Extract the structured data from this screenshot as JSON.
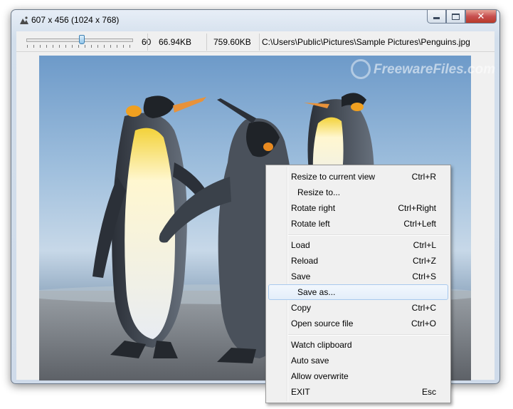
{
  "window": {
    "title": "607 x 456 (1024 x 768)",
    "caption_buttons": {
      "minimize_icon": "minimize-icon",
      "maximize_icon": "maximize-icon",
      "close_glyph": "✕"
    }
  },
  "toolbar": {
    "zoom_slider_value": "60",
    "file_size": "66.94KB",
    "memory_size": "759.60KB",
    "file_path": "C:\\Users\\Public\\Pictures\\Sample Pictures\\Penguins.jpg"
  },
  "watermark": {
    "text": "FreewareFiles.com"
  },
  "context_menu": {
    "hovered_item": "Save as...",
    "groups": [
      [
        {
          "label": "Resize to current view",
          "shortcut": "Ctrl+R"
        },
        {
          "label": "Resize to...",
          "shortcut": ""
        },
        {
          "label": "Rotate right",
          "shortcut": "Ctrl+Right"
        },
        {
          "label": "Rotate left",
          "shortcut": "Ctrl+Left"
        }
      ],
      [
        {
          "label": "Load",
          "shortcut": "Ctrl+L"
        },
        {
          "label": "Reload",
          "shortcut": "Ctrl+Z"
        },
        {
          "label": "Save",
          "shortcut": "Ctrl+S"
        },
        {
          "label": "Save as...",
          "shortcut": ""
        },
        {
          "label": "Copy",
          "shortcut": "Ctrl+C"
        },
        {
          "label": "Open source file",
          "shortcut": "Ctrl+O"
        }
      ],
      [
        {
          "label": "Watch clipboard",
          "shortcut": ""
        },
        {
          "label": "Auto save",
          "shortcut": ""
        },
        {
          "label": "Allow overwrite",
          "shortcut": ""
        },
        {
          "label": "EXIT",
          "shortcut": "Esc"
        }
      ]
    ]
  },
  "colors": {
    "window_frame": "#cfdbea",
    "menu_background": "#f0f0f0",
    "menu_hover_border": "#a8c9ee",
    "close_button": "#c75050"
  }
}
